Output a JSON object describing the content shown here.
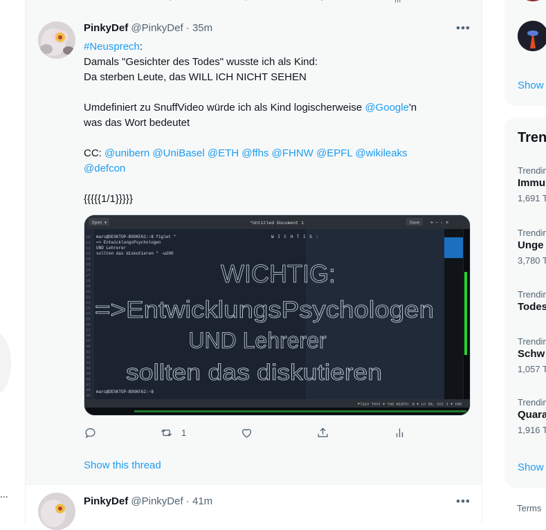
{
  "tweets": [
    {
      "name": "PinkyDef",
      "handle": "@PinkyDef",
      "time": "35m",
      "lines": [
        [
          {
            "t": "#Neusprech",
            "link": true
          },
          {
            "t": ":"
          }
        ],
        [
          {
            "t": "Damals \"Gesichter des Todes\" wusste ich als Kind:"
          }
        ],
        [
          {
            "t": "Da sterben Leute, das WILL ICH NICHT SEHEN"
          }
        ],
        [],
        [
          {
            "t": "Umdefiniert zu SnuffVideo würde ich als Kind logischerweise "
          },
          {
            "t": "@Google",
            "link": true
          },
          {
            "t": "'n"
          }
        ],
        [
          {
            "t": "was das Wort bedeutet"
          }
        ],
        [],
        [
          {
            "t": "CC: "
          },
          {
            "t": "@unibern",
            "link": true
          },
          {
            "t": " "
          },
          {
            "t": "@UniBasel",
            "link": true
          },
          {
            "t": " "
          },
          {
            "t": "@ETH",
            "link": true
          },
          {
            "t": " "
          },
          {
            "t": "@ffhs",
            "link": true
          },
          {
            "t": " "
          },
          {
            "t": "@FHNW",
            "link": true
          },
          {
            "t": " "
          },
          {
            "t": "@EPFL",
            "link": true
          },
          {
            "t": " "
          },
          {
            "t": "@wikileaks",
            "link": true
          }
        ],
        [
          {
            "t": "@defcon",
            "link": true
          }
        ],
        [],
        [
          {
            "t": "{{{{{1/1}}}}}"
          }
        ]
      ],
      "retweet_count": "1",
      "show_thread": "Show this thread",
      "media": {
        "window_title": "*Untitled Document 1",
        "open_label": "Open ▾",
        "save_label": "Save",
        "terminal_lines": [
          "marc@DESKTOP-B99KF62:~$ figlet \"",
          "=> EntwicklungsPsychologen",
          "            UND Lehrerer",
          "    sollten das diskutieren \" -w200"
        ],
        "banner_header": "W I C H T I G :",
        "banner": [
          "WICHTIG:",
          "=>EntwicklungsPsychologen",
          "UND Lehrerer",
          "sollten das diskutieren"
        ],
        "prompt_end": "marc@DESKTOP-B99KF62:~$",
        "status_bar": "Plain Text ▾    Tab Width: 8 ▾    Ln 39, Col 1  ▾    INS"
      }
    },
    {
      "name": "PinkyDef",
      "handle": "@PinkyDef",
      "time": "41m"
    }
  ],
  "sidebar": {
    "who_to_follow_show_more": "Show",
    "trends_title": "Tren",
    "trends": [
      {
        "meta": "Trendin",
        "topic": "Immu",
        "count": "1,691 T"
      },
      {
        "meta": "Trendin",
        "topic": "Unge",
        "count": "3,780 T"
      },
      {
        "meta": "Trendin",
        "topic": "Todes",
        "count": ""
      },
      {
        "meta": "Trendin",
        "topic": "Schw",
        "count": "1,057 T"
      },
      {
        "meta": "Trendin",
        "topic": "Quara",
        "count": "1,916 T"
      }
    ],
    "trends_show_more": "Show",
    "terms": "Terms"
  },
  "left": {
    "more_dots": "..."
  },
  "colors": {
    "accent": "#1d9bf0",
    "text": "#0f1419",
    "muted": "#536471",
    "panel": "#f7f9f9",
    "terminal_bg": "#1b2331",
    "terminal_fg": "#c9d4e0"
  }
}
